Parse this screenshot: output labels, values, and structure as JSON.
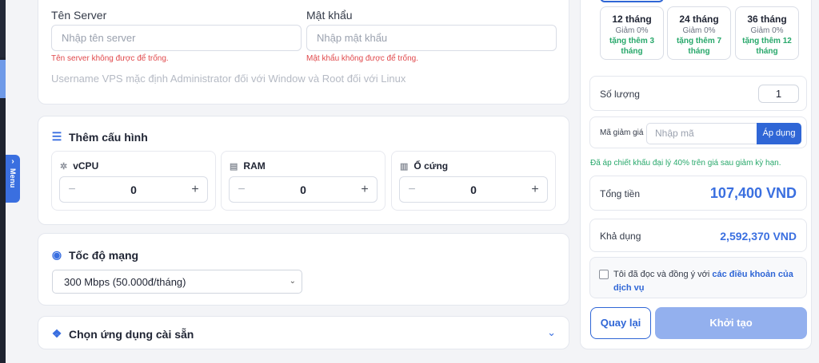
{
  "sidebar": {
    "menu_label": "Menu",
    "menu_icon": "chevron-right-icon"
  },
  "server": {
    "name_label": "Tên Server",
    "name_placeholder": "Nhập tên server",
    "name_error": "Tên server không được để trống.",
    "password_label": "Mật khẩu",
    "password_placeholder": "Nhập mật khẩu",
    "password_error": "Mật khẩu không được để trống.",
    "hint": "Username VPS mặc định Administrator đối với Window và Root đối với Linux"
  },
  "config": {
    "title": "Thêm cấu hình",
    "icon": "sliders-icon",
    "items": [
      {
        "label": "vCPU",
        "icon": "cpu-icon",
        "value": "0",
        "minus": "−",
        "plus": "+"
      },
      {
        "label": "RAM",
        "icon": "memory-icon",
        "value": "0",
        "minus": "−",
        "plus": "+"
      },
      {
        "label": "Ổ cứng",
        "icon": "disk-icon",
        "value": "0",
        "minus": "−",
        "plus": "+"
      }
    ]
  },
  "network": {
    "title": "Tốc độ mạng",
    "icon": "speedometer-icon",
    "selected": "300 Mbps (50.000đ/tháng)"
  },
  "apps": {
    "title": "Chọn ứng dụng cài sẵn",
    "icon": "cubes-icon"
  },
  "terms": [
    {
      "name": "12 tháng",
      "discount": "Giảm 0%",
      "bonus": "tặng thêm 3 tháng"
    },
    {
      "name": "24 tháng",
      "discount": "Giảm 0%",
      "bonus": "tặng thêm 7 tháng"
    },
    {
      "name": "36 tháng",
      "discount": "Giảm 0%",
      "bonus": "tặng thêm 12 tháng"
    }
  ],
  "order": {
    "quantity_label": "Số lượng",
    "quantity_value": "1",
    "coupon_label": "Mã giảm giá",
    "coupon_placeholder": "Nhập mã",
    "coupon_button": "Áp dụng",
    "agency_note": "Đã áp chiết khấu đại lý 40% trên giá sau giảm kỳ hạn.",
    "total_label": "Tổng tiền",
    "total_value": "107,400 VND",
    "balance_label": "Khả dụng",
    "balance_value": "2,592,370 VND",
    "agree_text": "Tôi đã đọc và đồng ý với ",
    "agree_link": "các điều khoản của dịch vụ",
    "back_button": "Quay lại",
    "create_button": "Khởi tạo"
  },
  "colors": {
    "accent": "#2f66d6",
    "success": "#28a86b",
    "error": "#e0484b"
  }
}
